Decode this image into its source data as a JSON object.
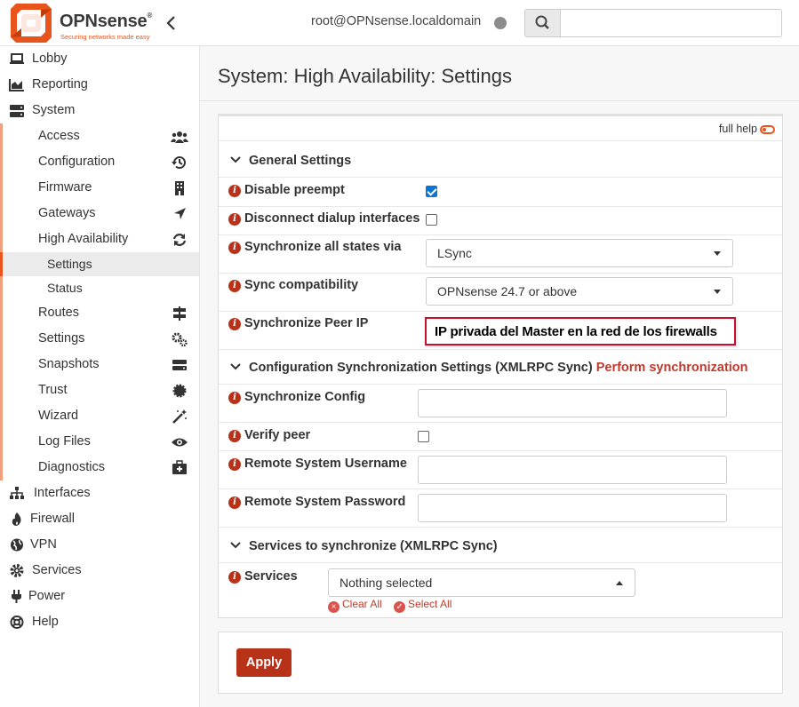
{
  "header": {
    "logo_text": "OPNsense",
    "logo_mark": "®",
    "logo_tagline": "Securing networks made easy",
    "user": "root@OPNsense.localdomain",
    "search_placeholder": ""
  },
  "sidebar": {
    "top_items": [
      {
        "label": "Lobby",
        "icon": "laptop-icon"
      },
      {
        "label": "Reporting",
        "icon": "area-chart-icon"
      },
      {
        "label": "System",
        "icon": "server-icon"
      }
    ],
    "system_children": [
      {
        "label": "Access",
        "icon": "users-icon"
      },
      {
        "label": "Configuration",
        "icon": "history-icon"
      },
      {
        "label": "Firmware",
        "icon": "building-icon"
      },
      {
        "label": "Gateways",
        "icon": "location-arrow-icon"
      },
      {
        "label": "High Availability",
        "icon": "refresh-icon"
      }
    ],
    "ha_children": [
      {
        "label": "Settings",
        "active": true
      },
      {
        "label": "Status",
        "active": false
      }
    ],
    "system_children_2": [
      {
        "label": "Routes",
        "icon": "signs-icon"
      },
      {
        "label": "Settings",
        "icon": "cogs-icon"
      },
      {
        "label": "Snapshots",
        "icon": "hdd-icon"
      },
      {
        "label": "Trust",
        "icon": "certificate-icon"
      },
      {
        "label": "Wizard",
        "icon": "magic-icon"
      },
      {
        "label": "Log Files",
        "icon": "eye-icon"
      },
      {
        "label": "Diagnostics",
        "icon": "medkit-icon"
      }
    ],
    "bottom_items": [
      {
        "label": "Interfaces",
        "icon": "sitemap-icon"
      },
      {
        "label": "Firewall",
        "icon": "fire-icon"
      },
      {
        "label": "VPN",
        "icon": "globe-icon"
      },
      {
        "label": "Services",
        "icon": "cog-icon"
      },
      {
        "label": "Power",
        "icon": "plug-icon"
      },
      {
        "label": "Help",
        "icon": "life-ring-icon"
      }
    ]
  },
  "page": {
    "title": "System: High Availability: Settings",
    "full_help": "full help"
  },
  "sections": {
    "general": "General Settings",
    "config_sync": "Configuration Synchronization Settings (XMLRPC Sync)",
    "perform_sync": "Perform synchronization",
    "services_sync": "Services to synchronize (XMLRPC Sync)"
  },
  "fields": {
    "disable_preempt": {
      "label": "Disable preempt",
      "checked": true
    },
    "disconnect_dialup": {
      "label": "Disconnect dialup interfaces",
      "checked": false
    },
    "sync_states_via": {
      "label": "Synchronize all states via",
      "value": "LSync"
    },
    "sync_compat": {
      "label": "Sync compatibility",
      "value": "OPNsense 24.7 or above"
    },
    "sync_peer_ip": {
      "label": "Synchronize Peer IP",
      "annotation": "IP privada del Master en la red de los firewalls"
    },
    "sync_config": {
      "label": "Synchronize Config",
      "value": ""
    },
    "verify_peer": {
      "label": "Verify peer",
      "checked": false
    },
    "remote_user": {
      "label": "Remote System Username",
      "value": ""
    },
    "remote_pass": {
      "label": "Remote System Password",
      "value": ""
    },
    "services": {
      "label": "Services",
      "value": "Nothing selected",
      "clear_all": "Clear All",
      "select_all": "Select All"
    }
  },
  "actions": {
    "apply": "Apply"
  },
  "colors": {
    "brand": "#e8541c",
    "accent_red": "#b8321a",
    "checkbox_blue": "#0a75d8",
    "annotation_border": "#c8102e"
  }
}
